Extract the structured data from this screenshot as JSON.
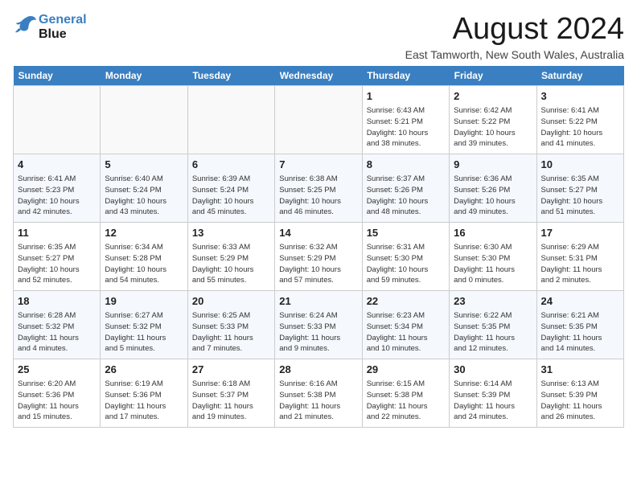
{
  "header": {
    "logo_line1": "General",
    "logo_line2": "Blue",
    "month": "August 2024",
    "location": "East Tamworth, New South Wales, Australia"
  },
  "days_of_week": [
    "Sunday",
    "Monday",
    "Tuesday",
    "Wednesday",
    "Thursday",
    "Friday",
    "Saturday"
  ],
  "weeks": [
    [
      {
        "day": "",
        "info": ""
      },
      {
        "day": "",
        "info": ""
      },
      {
        "day": "",
        "info": ""
      },
      {
        "day": "",
        "info": ""
      },
      {
        "day": "1",
        "info": "Sunrise: 6:43 AM\nSunset: 5:21 PM\nDaylight: 10 hours\nand 38 minutes."
      },
      {
        "day": "2",
        "info": "Sunrise: 6:42 AM\nSunset: 5:22 PM\nDaylight: 10 hours\nand 39 minutes."
      },
      {
        "day": "3",
        "info": "Sunrise: 6:41 AM\nSunset: 5:22 PM\nDaylight: 10 hours\nand 41 minutes."
      }
    ],
    [
      {
        "day": "4",
        "info": "Sunrise: 6:41 AM\nSunset: 5:23 PM\nDaylight: 10 hours\nand 42 minutes."
      },
      {
        "day": "5",
        "info": "Sunrise: 6:40 AM\nSunset: 5:24 PM\nDaylight: 10 hours\nand 43 minutes."
      },
      {
        "day": "6",
        "info": "Sunrise: 6:39 AM\nSunset: 5:24 PM\nDaylight: 10 hours\nand 45 minutes."
      },
      {
        "day": "7",
        "info": "Sunrise: 6:38 AM\nSunset: 5:25 PM\nDaylight: 10 hours\nand 46 minutes."
      },
      {
        "day": "8",
        "info": "Sunrise: 6:37 AM\nSunset: 5:26 PM\nDaylight: 10 hours\nand 48 minutes."
      },
      {
        "day": "9",
        "info": "Sunrise: 6:36 AM\nSunset: 5:26 PM\nDaylight: 10 hours\nand 49 minutes."
      },
      {
        "day": "10",
        "info": "Sunrise: 6:35 AM\nSunset: 5:27 PM\nDaylight: 10 hours\nand 51 minutes."
      }
    ],
    [
      {
        "day": "11",
        "info": "Sunrise: 6:35 AM\nSunset: 5:27 PM\nDaylight: 10 hours\nand 52 minutes."
      },
      {
        "day": "12",
        "info": "Sunrise: 6:34 AM\nSunset: 5:28 PM\nDaylight: 10 hours\nand 54 minutes."
      },
      {
        "day": "13",
        "info": "Sunrise: 6:33 AM\nSunset: 5:29 PM\nDaylight: 10 hours\nand 55 minutes."
      },
      {
        "day": "14",
        "info": "Sunrise: 6:32 AM\nSunset: 5:29 PM\nDaylight: 10 hours\nand 57 minutes."
      },
      {
        "day": "15",
        "info": "Sunrise: 6:31 AM\nSunset: 5:30 PM\nDaylight: 10 hours\nand 59 minutes."
      },
      {
        "day": "16",
        "info": "Sunrise: 6:30 AM\nSunset: 5:30 PM\nDaylight: 11 hours\nand 0 minutes."
      },
      {
        "day": "17",
        "info": "Sunrise: 6:29 AM\nSunset: 5:31 PM\nDaylight: 11 hours\nand 2 minutes."
      }
    ],
    [
      {
        "day": "18",
        "info": "Sunrise: 6:28 AM\nSunset: 5:32 PM\nDaylight: 11 hours\nand 4 minutes."
      },
      {
        "day": "19",
        "info": "Sunrise: 6:27 AM\nSunset: 5:32 PM\nDaylight: 11 hours\nand 5 minutes."
      },
      {
        "day": "20",
        "info": "Sunrise: 6:25 AM\nSunset: 5:33 PM\nDaylight: 11 hours\nand 7 minutes."
      },
      {
        "day": "21",
        "info": "Sunrise: 6:24 AM\nSunset: 5:33 PM\nDaylight: 11 hours\nand 9 minutes."
      },
      {
        "day": "22",
        "info": "Sunrise: 6:23 AM\nSunset: 5:34 PM\nDaylight: 11 hours\nand 10 minutes."
      },
      {
        "day": "23",
        "info": "Sunrise: 6:22 AM\nSunset: 5:35 PM\nDaylight: 11 hours\nand 12 minutes."
      },
      {
        "day": "24",
        "info": "Sunrise: 6:21 AM\nSunset: 5:35 PM\nDaylight: 11 hours\nand 14 minutes."
      }
    ],
    [
      {
        "day": "25",
        "info": "Sunrise: 6:20 AM\nSunset: 5:36 PM\nDaylight: 11 hours\nand 15 minutes."
      },
      {
        "day": "26",
        "info": "Sunrise: 6:19 AM\nSunset: 5:36 PM\nDaylight: 11 hours\nand 17 minutes."
      },
      {
        "day": "27",
        "info": "Sunrise: 6:18 AM\nSunset: 5:37 PM\nDaylight: 11 hours\nand 19 minutes."
      },
      {
        "day": "28",
        "info": "Sunrise: 6:16 AM\nSunset: 5:38 PM\nDaylight: 11 hours\nand 21 minutes."
      },
      {
        "day": "29",
        "info": "Sunrise: 6:15 AM\nSunset: 5:38 PM\nDaylight: 11 hours\nand 22 minutes."
      },
      {
        "day": "30",
        "info": "Sunrise: 6:14 AM\nSunset: 5:39 PM\nDaylight: 11 hours\nand 24 minutes."
      },
      {
        "day": "31",
        "info": "Sunrise: 6:13 AM\nSunset: 5:39 PM\nDaylight: 11 hours\nand 26 minutes."
      }
    ]
  ]
}
